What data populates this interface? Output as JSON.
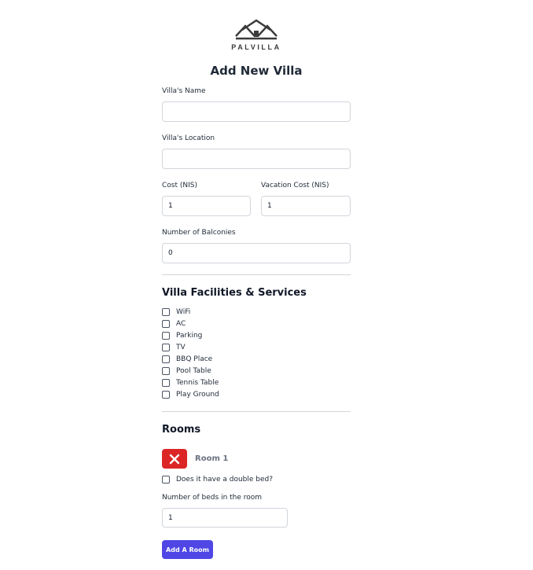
{
  "brand": {
    "name": "PALVILLA"
  },
  "form": {
    "title": "Add New Villa",
    "name_label": "Villa's Name",
    "name_value": "",
    "location_label": "Villa's Location",
    "location_value": "",
    "cost_label": "Cost (NIS)",
    "cost_value": "1",
    "vacation_cost_label": "Vacation Cost (NIS)",
    "vacation_cost_value": "1",
    "balconies_label": "Number of Balconies",
    "balconies_value": "0"
  },
  "facilities": {
    "heading": "Villa Facilities & Services",
    "items": [
      {
        "label": "WiFi",
        "checked": false
      },
      {
        "label": "AC",
        "checked": false
      },
      {
        "label": "Parking",
        "checked": false
      },
      {
        "label": "TV",
        "checked": false
      },
      {
        "label": "BBQ Place",
        "checked": false
      },
      {
        "label": "Pool Table",
        "checked": false
      },
      {
        "label": "Tennis Table",
        "checked": false
      },
      {
        "label": "Play Ground",
        "checked": false
      }
    ]
  },
  "rooms": {
    "heading": "Room",
    "heading_full": "Rooms",
    "room": {
      "title": "Room 1",
      "double_bed_label": "Does it have a double bed?",
      "double_bed_checked": false,
      "beds_label": "Number of beds in the room",
      "beds_value": "1"
    },
    "add_button_label": "Add A Room"
  },
  "colors": {
    "primary": "#4f46e5",
    "danger": "#dc2626",
    "room_title": "#6b7280"
  }
}
